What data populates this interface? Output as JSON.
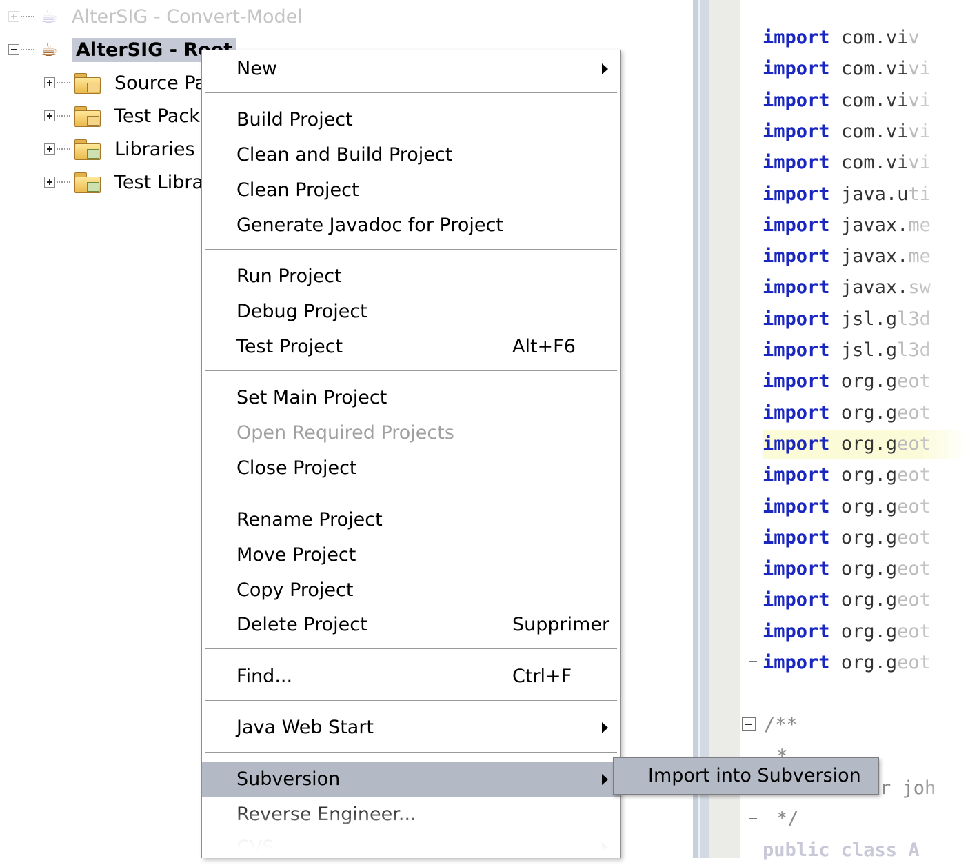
{
  "tree": {
    "other_project": "AlterSIG - Convert-Model",
    "root_project": "AlterSIG - Root",
    "children": [
      "Source Pa",
      "Test Pack",
      "Libraries",
      "Test Libra"
    ]
  },
  "context_menu": {
    "new": "New",
    "build_project": "Build Project",
    "clean_build_project": "Clean and Build Project",
    "clean_project": "Clean Project",
    "generate_javadoc": "Generate Javadoc for Project",
    "run_project": "Run Project",
    "debug_project": "Debug Project",
    "test_project": "Test Project",
    "test_project_shortcut": "Alt+F6",
    "set_main_project": "Set Main Project",
    "open_required_projects": "Open Required Projects",
    "close_project": "Close Project",
    "rename_project": "Rename Project",
    "move_project": "Move Project",
    "copy_project": "Copy Project",
    "delete_project": "Delete Project",
    "delete_project_shortcut": "Supprimer",
    "find": "Find...",
    "find_shortcut": "Ctrl+F",
    "java_web_start": "Java Web Start",
    "subversion": "Subversion",
    "reverse_engineer": "Reverse Engineer...",
    "cvs": "CVS"
  },
  "submenu": {
    "import_into_subversion": "Import into Subversion"
  },
  "editor": {
    "imports": [
      {
        "kw": "import",
        "pkg": "com.vi",
        "tail": "v"
      },
      {
        "kw": "import",
        "pkg": "com.vi",
        "tail": "vi"
      },
      {
        "kw": "import",
        "pkg": "com.vi",
        "tail": "vi"
      },
      {
        "kw": "import",
        "pkg": "com.vi",
        "tail": "vi"
      },
      {
        "kw": "import",
        "pkg": "com.vi",
        "tail": "vi"
      },
      {
        "kw": "import",
        "pkg": "java.u",
        "tail": "ti"
      },
      {
        "kw": "import",
        "pkg": "javax.",
        "tail": "me"
      },
      {
        "kw": "import",
        "pkg": "javax.",
        "tail": "me"
      },
      {
        "kw": "import",
        "pkg": "javax.",
        "tail": "sw"
      },
      {
        "kw": "import",
        "pkg": "jsl.g",
        "tail": "l3d"
      },
      {
        "kw": "import",
        "pkg": "jsl.g",
        "tail": "l3d"
      },
      {
        "kw": "import",
        "pkg": "org.g",
        "tail": "eot"
      },
      {
        "kw": "import",
        "pkg": "org.g",
        "tail": "eot"
      },
      {
        "kw": "import",
        "pkg": "org.g",
        "tail": "eot"
      },
      {
        "kw": "import",
        "pkg": "org.g",
        "tail": "eot"
      },
      {
        "kw": "import",
        "pkg": "org.g",
        "tail": "eot"
      },
      {
        "kw": "import",
        "pkg": "org.g",
        "tail": "eot"
      },
      {
        "kw": "import",
        "pkg": "org.g",
        "tail": "eot"
      },
      {
        "kw": "import",
        "pkg": "org.g",
        "tail": "eot"
      },
      {
        "kw": "import",
        "pkg": "org.g",
        "tail": "eot"
      },
      {
        "kw": "import",
        "pkg": "org.g",
        "tail": "eot"
      }
    ],
    "comment_open": "/**",
    "comment_star": "*",
    "comment_author_fragment": "r joh",
    "comment_close": "*/",
    "class_decl_fragment": "public class A"
  }
}
